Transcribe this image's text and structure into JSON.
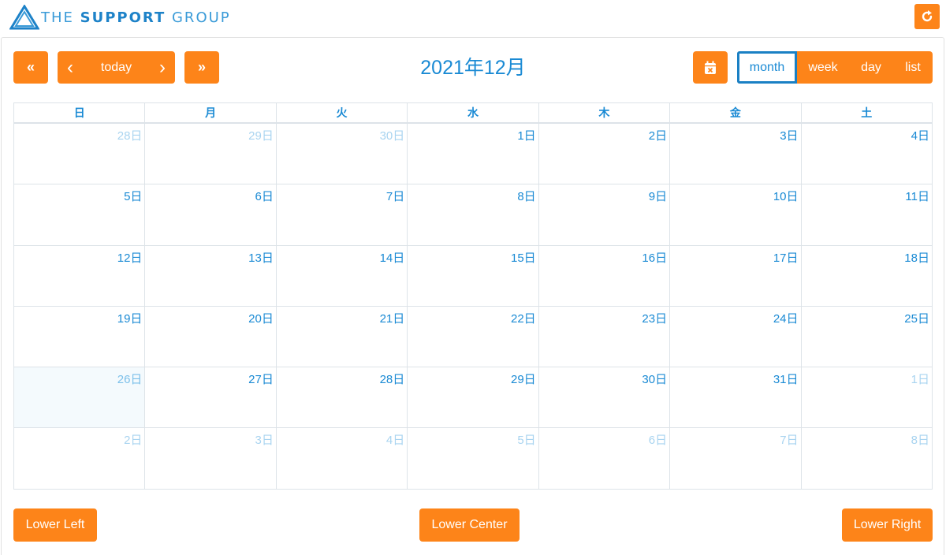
{
  "brand": {
    "name_light_1": "THE",
    "name_bold": "SUPPORT",
    "name_light_2": "GROUP",
    "accent_color": "#fd8419",
    "primary_color": "#1a8ad4"
  },
  "toolbar": {
    "prev_year_label": "«",
    "prev_label": "‹",
    "today_label": "today",
    "next_label": "›",
    "next_year_label": "»",
    "title": "2021年12月",
    "views": [
      {
        "label": "month",
        "active": true
      },
      {
        "label": "week",
        "active": false
      },
      {
        "label": "day",
        "active": false
      },
      {
        "label": "list",
        "active": false
      }
    ]
  },
  "calendar": {
    "weekdays": [
      "日",
      "月",
      "火",
      "水",
      "木",
      "金",
      "土"
    ],
    "weeks": [
      [
        {
          "label": "28日",
          "other": true
        },
        {
          "label": "29日",
          "other": true
        },
        {
          "label": "30日",
          "other": true
        },
        {
          "label": "1日"
        },
        {
          "label": "2日"
        },
        {
          "label": "3日"
        },
        {
          "label": "4日"
        }
      ],
      [
        {
          "label": "5日"
        },
        {
          "label": "6日"
        },
        {
          "label": "7日"
        },
        {
          "label": "8日"
        },
        {
          "label": "9日"
        },
        {
          "label": "10日"
        },
        {
          "label": "11日"
        }
      ],
      [
        {
          "label": "12日"
        },
        {
          "label": "13日"
        },
        {
          "label": "14日"
        },
        {
          "label": "15日"
        },
        {
          "label": "16日"
        },
        {
          "label": "17日"
        },
        {
          "label": "18日"
        }
      ],
      [
        {
          "label": "19日"
        },
        {
          "label": "20日"
        },
        {
          "label": "21日"
        },
        {
          "label": "22日"
        },
        {
          "label": "23日"
        },
        {
          "label": "24日"
        },
        {
          "label": "25日"
        }
      ],
      [
        {
          "label": "26日",
          "today": true
        },
        {
          "label": "27日"
        },
        {
          "label": "28日"
        },
        {
          "label": "29日"
        },
        {
          "label": "30日"
        },
        {
          "label": "31日"
        },
        {
          "label": "1日",
          "other": true
        }
      ],
      [
        {
          "label": "2日",
          "other": true
        },
        {
          "label": "3日",
          "other": true
        },
        {
          "label": "4日",
          "other": true
        },
        {
          "label": "5日",
          "other": true
        },
        {
          "label": "6日",
          "other": true
        },
        {
          "label": "7日",
          "other": true
        },
        {
          "label": "8日",
          "other": true
        }
      ]
    ]
  },
  "footer": {
    "lower_left": "Lower Left",
    "lower_center": "Lower Center",
    "lower_right": "Lower Right"
  }
}
